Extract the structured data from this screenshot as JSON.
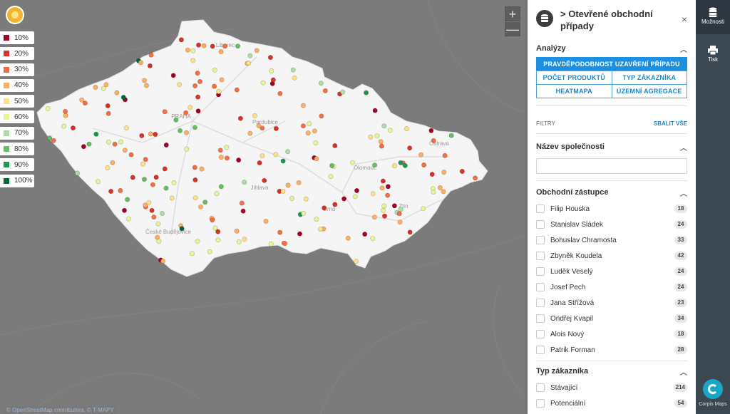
{
  "map": {
    "country_fill": "#f5f5f5",
    "region_labels": [
      "Liberec",
      "PRAHA",
      "Pardubice",
      "Jihlava",
      "Olomouc",
      "Ostrava",
      "Brno",
      "Zlín",
      "České Budějovice"
    ],
    "legend": [
      {
        "label": "10%",
        "color": "#a50026"
      },
      {
        "label": "20%",
        "color": "#d73027"
      },
      {
        "label": "30%",
        "color": "#f46d43"
      },
      {
        "label": "40%",
        "color": "#fdae61"
      },
      {
        "label": "50%",
        "color": "#fee08b"
      },
      {
        "label": "60%",
        "color": "#e6f598"
      },
      {
        "label": "70%",
        "color": "#abdda4"
      },
      {
        "label": "80%",
        "color": "#66bd63"
      },
      {
        "label": "90%",
        "color": "#1a9850"
      },
      {
        "label": "100%",
        "color": "#006837"
      }
    ],
    "zoom_in": "+",
    "zoom_out": "—",
    "attribution": "© OpenStreetMap contributors, © T-MAPY"
  },
  "panel": {
    "title": "> Otevřené obchodní případy",
    "close": "×",
    "analyses_heading": "Analýzy",
    "analysis_buttons": {
      "probability": "PRAVDĚPODOBNOST UZAVŘENÍ PŘÍPADU",
      "product_count": "POČET PRODUKTŮ",
      "customer_type": "TYP ZÁKAZNÍKA",
      "heatmap": "HEATMAPA",
      "territorial": "ÚZEMNÍ AGREGACE"
    },
    "filters_label": "FILTRY",
    "collapse_all": "SBALIT VŠE",
    "company_heading": "Název společnosti",
    "company_value": "",
    "rep_heading": "Obchodní zástupce",
    "reps": [
      {
        "name": "Filip Houska",
        "count": "18"
      },
      {
        "name": "Stanislav Sládek",
        "count": "24"
      },
      {
        "name": "Bohuslav Chramosta",
        "count": "33"
      },
      {
        "name": "Zbyněk Koudela",
        "count": "42"
      },
      {
        "name": "Luděk Veselý",
        "count": "24"
      },
      {
        "name": "Josef Pech",
        "count": "24"
      },
      {
        "name": "Jana Střížová",
        "count": "23"
      },
      {
        "name": "Ondřej Kvapil",
        "count": "34"
      },
      {
        "name": "Alois Nový",
        "count": "18"
      },
      {
        "name": "Patrik Forman",
        "count": "28"
      }
    ],
    "customer_heading": "Typ zákazníka",
    "customer_types": [
      {
        "name": "Stávající",
        "count": "214"
      },
      {
        "name": "Potenciální",
        "count": "54"
      }
    ],
    "accent_color": "#1d8fe0"
  },
  "sidebar": {
    "options_label": "Možnosti",
    "print_label": "Tisk",
    "brand_label": "Corpis Maps"
  }
}
